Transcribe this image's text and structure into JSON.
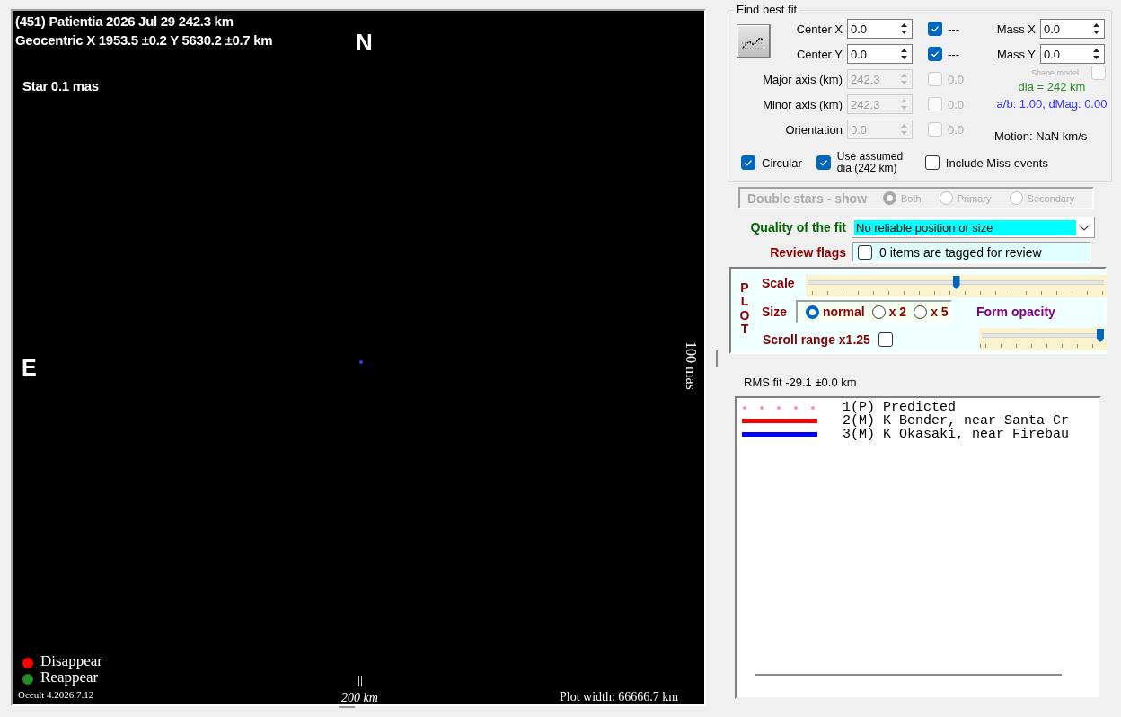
{
  "plot": {
    "title": "(451) Patientia  2026 Jul 29  242.3 km",
    "geocentric": "Geocentric  X  1953.5 ±0.2  Y 5630.2 ±0.7 km",
    "north": "N",
    "east": "E",
    "star": "Star 0.1 mas",
    "vertical_scale": "100 mas",
    "legend": [
      {
        "label": "Disappear",
        "color": "#ff0000"
      },
      {
        "label": "Reappear",
        "color": "#228b22"
      }
    ],
    "version": "Occult 4.2026.7.12",
    "scale_bar": "200 km",
    "plot_width": "Plot width: 66666.7 km"
  },
  "fit": {
    "title": "Find best fit",
    "center": [
      {
        "label": "Center X",
        "value": "0.0",
        "checked": true,
        "check_label": "---",
        "disabled": false
      },
      {
        "label": "Center Y",
        "value": "0.0",
        "checked": true,
        "check_label": "---",
        "disabled": false
      }
    ],
    "mass": [
      {
        "label": "Mass X",
        "value": "0.0"
      },
      {
        "label": "Mass Y",
        "value": "0.0"
      }
    ],
    "shape_model": {
      "label": "Shape model",
      "checked": false,
      "disabled": true
    },
    "axes": [
      {
        "label": "Major axis (km)",
        "value": "242.3",
        "checked": false,
        "check_label": "0.0",
        "disabled": true
      },
      {
        "label": "Minor axis (km)",
        "value": "242.3",
        "checked": false,
        "check_label": "0.0",
        "disabled": true
      },
      {
        "label": "Orientation",
        "value": "0.0",
        "checked": false,
        "check_label": "0.0",
        "disabled": true
      }
    ],
    "dia": "dia = 242 km",
    "ratio": "a/b: 1.00, dMag: 0.00",
    "motion": "Motion: NaN km/s",
    "options": [
      {
        "label": "Circular",
        "checked": true
      },
      {
        "label": "Use assumed dia (242 km)",
        "checked": true
      },
      {
        "label": "Include Miss events",
        "checked": false
      }
    ]
  },
  "double_stars": {
    "label": "Double stars - show",
    "disabled": true,
    "options": [
      {
        "label": "Both",
        "selected": true
      },
      {
        "label": "Primary",
        "selected": false
      },
      {
        "label": "Secondary",
        "selected": false
      }
    ]
  },
  "quality": {
    "label": "Quality of the fit",
    "value": "No reliable position or size"
  },
  "review": {
    "label": "Review flags",
    "checked": false,
    "text": "0 items are tagged for review"
  },
  "plot_settings": {
    "title": "PLOT",
    "scale": {
      "label": "Scale",
      "level": 0.5
    },
    "size": {
      "label": "Size",
      "options": [
        {
          "label": "normal",
          "selected": true
        },
        {
          "label": "x 2",
          "selected": false
        },
        {
          "label": "x 5",
          "selected": false
        }
      ]
    },
    "opacity": {
      "label": "Form opacity",
      "level": 1.0
    },
    "scroll": {
      "label": "Scroll range x1.25",
      "checked": false
    }
  },
  "rms": "RMS fit -29.1 ±0.0 km",
  "observations": [
    {
      "kind": "dotted",
      "color": "#ff88cc",
      "text": "1(P) Predicted"
    },
    {
      "kind": "solid",
      "color": "#ff0000",
      "text": "2(M) K Bender, near Santa Cr"
    },
    {
      "kind": "solid",
      "color": "#0000ff",
      "text": "3(M) K Okasaki, near Firebau"
    }
  ]
}
